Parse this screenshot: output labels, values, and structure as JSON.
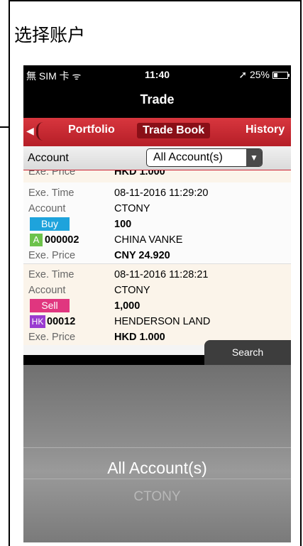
{
  "page": {
    "title": "选择账户"
  },
  "status_bar": {
    "carrier": "無 SIM 卡 ᯤ",
    "time": "11:40",
    "battery": "➚ 25%",
    "battery_level": 0.25
  },
  "navbar": {
    "title": "Trade"
  },
  "tabs": {
    "back": "◀",
    "items": [
      {
        "label": "Portfolio"
      },
      {
        "label": "Trade Book",
        "active": true
      },
      {
        "label": "History"
      }
    ]
  },
  "account_bar": {
    "label": "Account",
    "selected": "All Account(s)",
    "arrow": "▼"
  },
  "partial_row": {
    "key": "Exe. Price",
    "value": "HKD 1.000"
  },
  "trades": [
    {
      "exe_time_label": "Exe. Time",
      "exe_time": "08-11-2016 11:29:20",
      "account_label": "Account",
      "account": "CTONY",
      "side": "Buy",
      "quantity": "100",
      "market": "A",
      "code": "000002",
      "name": "CHINA VANKE",
      "price_label": "Exe. Price",
      "price": "CNY 24.920"
    },
    {
      "exe_time_label": "Exe. Time",
      "exe_time": "08-11-2016 11:28:21",
      "account_label": "Account",
      "account": "CTONY",
      "side": "Sell",
      "quantity": "1,000",
      "market": "HK",
      "code": "00012",
      "name": "HENDERSON LAND",
      "price_label": "Exe. Price",
      "price": "HKD 1.000"
    }
  ],
  "toolbar": {
    "search_label": "Search"
  },
  "picker": {
    "options": [
      "All Account(s)",
      "CTONY"
    ],
    "selected": "All Account(s)"
  },
  "colors": {
    "tab_red": "#c8262e",
    "buy": "#1ea3dc",
    "sell": "#e0367f",
    "market_a": "#6cc24a",
    "market_hk": "#9a3bd0"
  }
}
